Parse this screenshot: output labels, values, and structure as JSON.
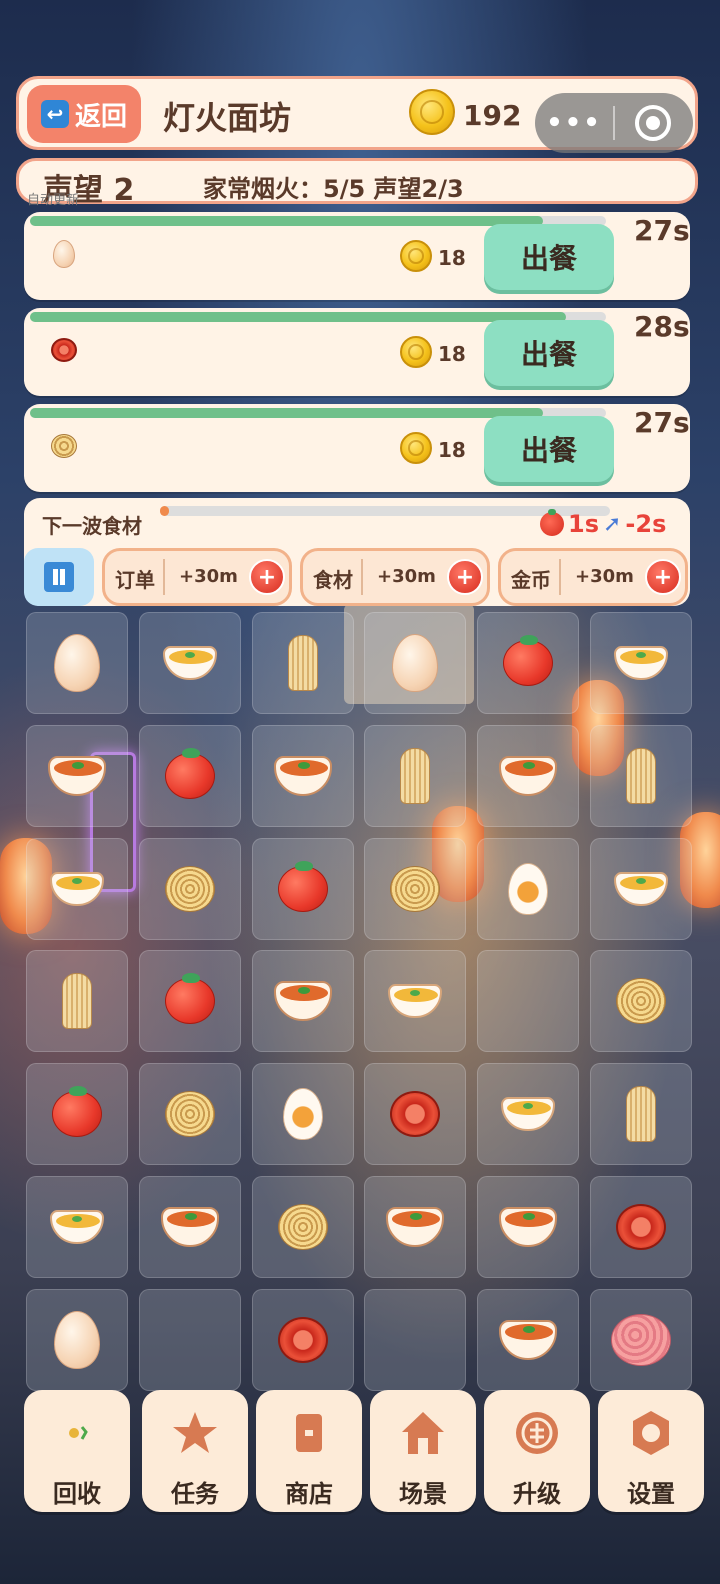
{
  "header": {
    "back_label": "返回",
    "shop_title": "灯火面坊",
    "coins": "192",
    "capsule_more": "•••"
  },
  "reputation": {
    "level_text": "声望 2",
    "progress_text": "家常烟火：5/5 声望2/3",
    "auto_update": "自动更新"
  },
  "orders": [
    {
      "item_icon": "egg-icon",
      "reward": "18",
      "serve_label": "出餐",
      "time": "27s",
      "progress": 0.89
    },
    {
      "item_icon": "tomato-slices-icon",
      "reward": "18",
      "serve_label": "出餐",
      "time": "28s",
      "progress": 0.93
    },
    {
      "item_icon": "noodle-nest-icon",
      "reward": "18",
      "serve_label": "出餐",
      "time": "27s",
      "progress": 0.89
    }
  ],
  "wave": {
    "label": "下一波食材",
    "progress": 0.02,
    "timer": "1s",
    "boost_text": "-2s",
    "boosts": [
      {
        "label": "订单",
        "time": "+30m",
        "plus": "+"
      },
      {
        "label": "食材",
        "time": "+30m",
        "plus": "+"
      },
      {
        "label": "金币",
        "time": "+30m",
        "plus": "+"
      }
    ]
  },
  "board": [
    [
      "egg",
      "bowl",
      "noodle-bundle",
      "egg",
      "tomato",
      "bowl"
    ],
    [
      "stew",
      "tomato",
      "stew",
      "noodle-bundle",
      "stew",
      "noodle-bundle"
    ],
    [
      "bowl",
      "noodle-nest",
      "tomato",
      "noodle-nest",
      "half-egg",
      "bowl"
    ],
    [
      "noodle-bundle",
      "tomato",
      "stew",
      "bowl",
      "",
      "noodle-nest"
    ],
    [
      "tomato",
      "noodle-nest",
      "half-egg",
      "tomato-slices",
      "bowl",
      "noodle-bundle"
    ],
    [
      "bowl",
      "stew",
      "noodle-nest",
      "stew",
      "stew",
      "tomato-slices"
    ],
    [
      "egg",
      "",
      "tomato-slices",
      "",
      "stew",
      "meat"
    ]
  ],
  "nav": [
    {
      "label": "回收",
      "icon": "recycle-icon"
    },
    {
      "label": "任务",
      "icon": "star-icon"
    },
    {
      "label": "商店",
      "icon": "shop-icon"
    },
    {
      "label": "场景",
      "icon": "house-icon"
    },
    {
      "label": "升级",
      "icon": "upgrade-icon"
    },
    {
      "label": "设置",
      "icon": "gear-icon"
    }
  ],
  "colors": {
    "accent": "#f3836a",
    "serve": "#8ddfc2",
    "progress": "#6fc08a",
    "nav_icon": "#d77a52",
    "timer_red": "#e8433a"
  }
}
